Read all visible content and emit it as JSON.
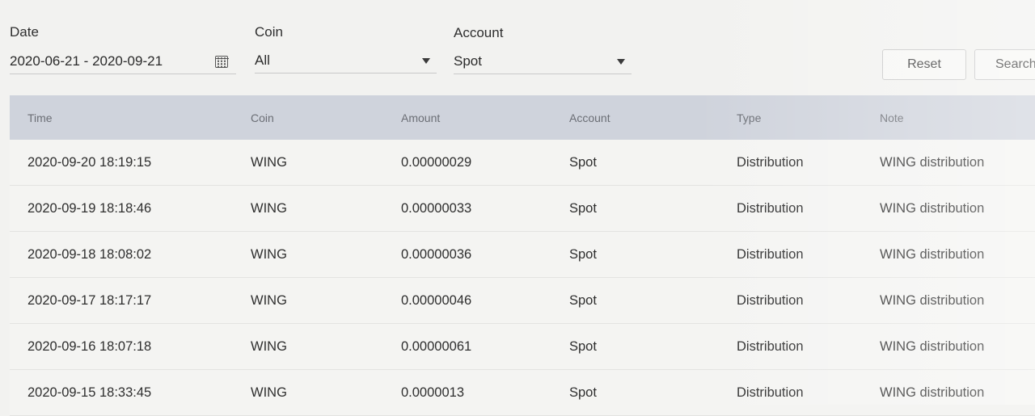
{
  "filters": {
    "date": {
      "label": "Date",
      "value": "2020-06-21 - 2020-09-21"
    },
    "coin": {
      "label": "Coin",
      "value": "All"
    },
    "account": {
      "label": "Account",
      "value": "Spot"
    },
    "reset_label": "Reset",
    "search_label": "Search"
  },
  "table": {
    "columns": [
      "Time",
      "Coin",
      "Amount",
      "Account",
      "Type",
      "Note"
    ],
    "rows": [
      [
        "2020-09-20 18:19:15",
        "WING",
        "0.00000029",
        "Spot",
        "Distribution",
        "WING distribution"
      ],
      [
        "2020-09-19 18:18:46",
        "WING",
        "0.00000033",
        "Spot",
        "Distribution",
        "WING distribution"
      ],
      [
        "2020-09-18 18:08:02",
        "WING",
        "0.00000036",
        "Spot",
        "Distribution",
        "WING distribution"
      ],
      [
        "2020-09-17 18:17:17",
        "WING",
        "0.00000046",
        "Spot",
        "Distribution",
        "WING distribution"
      ],
      [
        "2020-09-16 18:07:18",
        "WING",
        "0.00000061",
        "Spot",
        "Distribution",
        "WING distribution"
      ],
      [
        "2020-09-15 18:33:45",
        "WING",
        "0.0000013",
        "Spot",
        "Distribution",
        "WING distribution"
      ]
    ]
  },
  "icons": {
    "date_picker": "calendar-icon",
    "dropdown": "chevron-down-icon"
  },
  "colors": {
    "header_bg": "#cfd3dc",
    "page_bg": "#f2f2f0"
  }
}
